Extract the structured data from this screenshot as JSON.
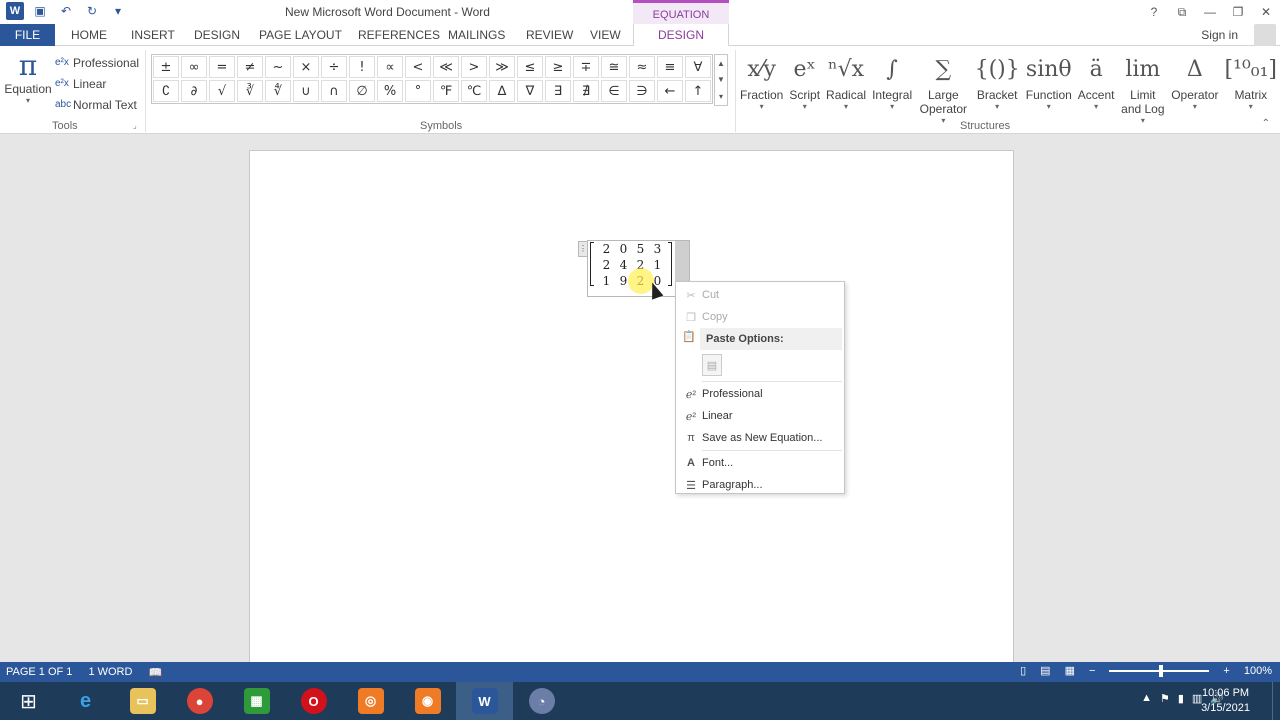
{
  "window": {
    "title": "New Microsoft Word Document - Word",
    "context_tab": "EQUATION TOOLS",
    "controls": [
      "?",
      "⧉",
      "—",
      "❐",
      "✕"
    ]
  },
  "tabs": {
    "file": "FILE",
    "items": [
      "HOME",
      "INSERT",
      "DESIGN",
      "PAGE LAYOUT",
      "REFERENCES",
      "MAILINGS",
      "REVIEW",
      "VIEW"
    ],
    "active": "DESIGN",
    "signin": "Sign in"
  },
  "ribbon": {
    "equation": {
      "icon": "π",
      "label": "Equation"
    },
    "tools": [
      {
        "icon": "e²x",
        "label": "Professional"
      },
      {
        "icon": "e²x",
        "label": "Linear"
      },
      {
        "icon": "abc",
        "label": "Normal Text"
      }
    ],
    "tools_group": "Tools",
    "symbols_group": "Symbols",
    "structures_group": "Structures",
    "symbols": [
      "±",
      "∞",
      "=",
      "≠",
      "~",
      "×",
      "÷",
      "!",
      "∝",
      "<",
      "≪",
      ">",
      "≫",
      "≤",
      "≥",
      "∓",
      "≅",
      "≈",
      "≡",
      "∀",
      "∁",
      "∂",
      "√",
      "∛",
      "∜",
      "∪",
      "∩",
      "∅",
      "%",
      "°",
      "℉",
      "℃",
      "∆",
      "∇",
      "∃",
      "∄",
      "∈",
      "∋",
      "←",
      "↑"
    ],
    "structures": [
      {
        "glyph": "x⁄y",
        "label": "Fraction"
      },
      {
        "glyph": "eˣ",
        "label": "Script"
      },
      {
        "glyph": "ⁿ√x",
        "label": "Radical"
      },
      {
        "glyph": "∫",
        "label": "Integral"
      },
      {
        "glyph": "∑",
        "label": "Large Operator"
      },
      {
        "glyph": "{()}",
        "label": "Bracket"
      },
      {
        "glyph": "sinθ",
        "label": "Function"
      },
      {
        "glyph": "ä",
        "label": "Accent"
      },
      {
        "glyph": "lim",
        "label": "Limit and Log"
      },
      {
        "glyph": "Δ",
        "label": "Operator"
      },
      {
        "glyph": "[¹⁰₀₁]",
        "label": "Matrix"
      }
    ]
  },
  "document": {
    "matrix": [
      [
        "2",
        "0",
        "5",
        "3"
      ],
      [
        "2",
        "4",
        "2",
        "1"
      ],
      [
        "1",
        "9",
        "2",
        "0"
      ]
    ]
  },
  "context_menu": {
    "cut": "Cut",
    "copy": "Copy",
    "paste_options": "Paste Options:",
    "professional": "Professional",
    "linear": "Linear",
    "save_new": "Save as New Equation...",
    "font": "Font...",
    "paragraph": "Paragraph..."
  },
  "statusbar": {
    "page": "PAGE 1 OF 1",
    "words": "1 WORD",
    "zoom": "100%"
  },
  "taskbar": {
    "time": "10:06 PM",
    "date": "3/15/2021"
  }
}
